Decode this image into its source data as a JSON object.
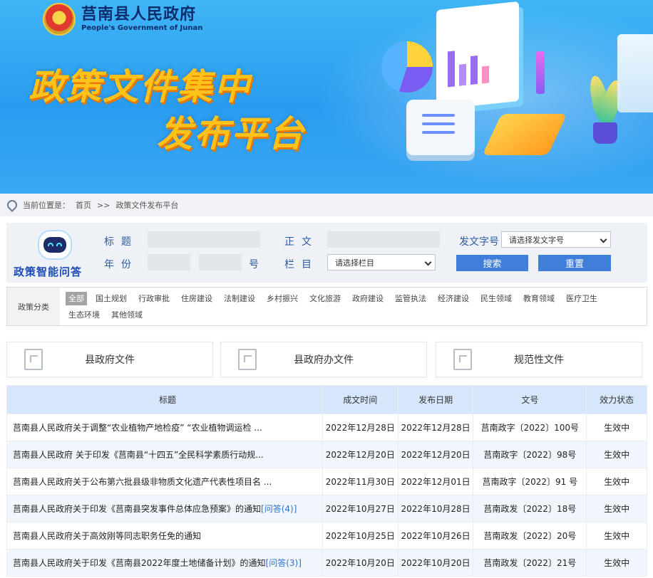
{
  "header": {
    "site_name_cn": "莒南县人民政府",
    "site_name_en": "People's Government of Junan",
    "banner_line1": "政策文件集中",
    "banner_line2": "发布平台"
  },
  "breadcrumb": {
    "prefix": "当前位置是：",
    "home": "首页",
    "sep": ">>",
    "current": "政策文件发布平台"
  },
  "search": {
    "assistant_label": "政策智能问答",
    "title_label": "标题",
    "body_label": "正文",
    "doc_no_label": "发文字号",
    "doc_no_placeholder": "请选择发文字号",
    "year_label": "年份",
    "num_suffix": "号",
    "column_label": "栏目",
    "column_placeholder": "请选择栏目",
    "search_button": "搜索",
    "reset_button": "重置"
  },
  "category": {
    "label": "政策分类",
    "items": [
      "全部",
      "国土规划",
      "行政审批",
      "住房建设",
      "法制建设",
      "乡村振兴",
      "文化旅游",
      "政府建设",
      "监管执法",
      "经济建设",
      "民生领域",
      "教育领域",
      "医疗卫生",
      "生态环境",
      "其他领域"
    ]
  },
  "tabs": [
    "县政府文件",
    "县政府办文件",
    "规范性文件"
  ],
  "table": {
    "headers": [
      "标题",
      "成文时间",
      "发布日期",
      "文号",
      "效力状态"
    ],
    "rows": [
      {
        "title": "莒南县人民政府关于调整“农业植物产地检疫” “农业植物调运检 ...",
        "qa": "",
        "time": "2022年12月28日",
        "date": "2022年12月28日",
        "no": "莒南政字〔2022〕100号",
        "status": "生效中"
      },
      {
        "title": "莒南县人民政府 关于印发《莒南县“十四五”全民科学素质行动规...",
        "qa": "",
        "time": "2022年12月20日",
        "date": "2022年12月20日",
        "no": "莒南政字〔2022〕98号",
        "status": "生效中"
      },
      {
        "title": "莒南县人民政府关于公布第六批县级非物质文化遗产代表性项目名 ...",
        "qa": "",
        "time": "2022年11月30日",
        "date": "2022年12月01日",
        "no": "莒南政字〔2022〕91 号",
        "status": "生效中"
      },
      {
        "title": "莒南县人民政府关于印发《莒南县突发事件总体应急预案》的通知",
        "qa": "[问答(4)]",
        "time": "2022年10月27日",
        "date": "2022年10月28日",
        "no": "莒南政发〔2022〕18号",
        "status": "生效中"
      },
      {
        "title": "莒南县人民政府关于高效刚等同志职务任免的通知",
        "qa": "",
        "time": "2022年10月25日",
        "date": "2022年10月26日",
        "no": "莒南政发〔2022〕20号",
        "status": "生效中"
      },
      {
        "title": "莒南县人民政府关于印发《莒南县2022年度土地储备计划》的通知",
        "qa": "[问答(3)]",
        "time": "2022年10月20日",
        "date": "2022年10月20日",
        "no": "莒南政发〔2022〕21号",
        "status": "生效中"
      }
    ]
  }
}
